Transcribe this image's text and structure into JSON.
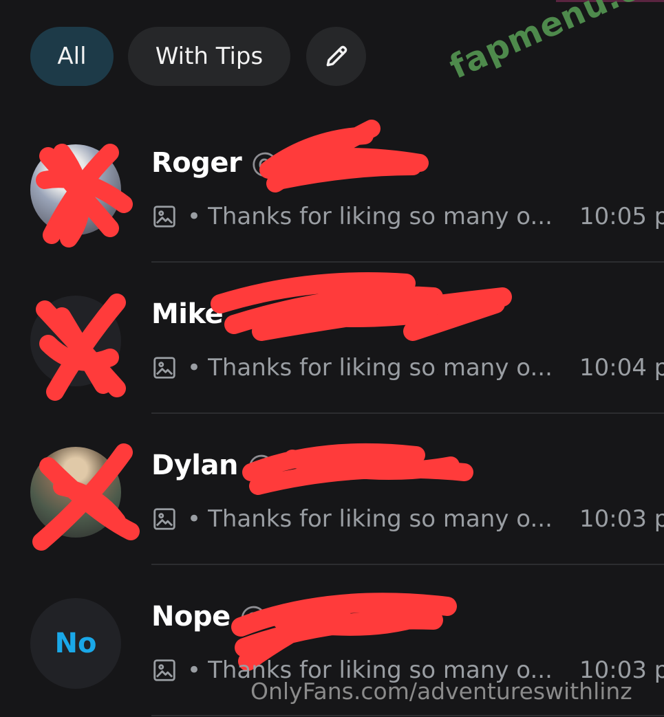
{
  "filters": {
    "all_label": "All",
    "tips_label": "With Tips",
    "edit_icon": "pencil-icon"
  },
  "conversations": [
    {
      "name": "Roger",
      "handle": "@",
      "preview_icon": "image-icon",
      "separator": "•",
      "preview": "Thanks for liking so many o...",
      "time": "10:05 p",
      "avatar": "photo"
    },
    {
      "name": "Mike",
      "handle": "",
      "preview_icon": "image-icon",
      "separator": "•",
      "preview": "Thanks for liking so many o...",
      "time": "10:04 p",
      "avatar": "photo"
    },
    {
      "name": "Dylan",
      "handle": "@",
      "preview_icon": "image-icon",
      "separator": "•",
      "preview": "Thanks for liking so many o...",
      "time": "10:03 p",
      "avatar": "photo"
    },
    {
      "name": "Nope",
      "handle": "@",
      "preview_icon": "image-icon",
      "separator": "•",
      "preview": "Thanks for liking so many o...",
      "time": "10:03 p",
      "avatar": "initials",
      "initials": "No"
    }
  ],
  "watermarks": {
    "site": "fapmenu.com",
    "source": "OnlyFans.com/adventureswithlinz"
  },
  "colors": {
    "background": "#161618",
    "chip_active": "#1d3a48",
    "chip_inactive": "#262729",
    "initials": "#1aa8e8",
    "redaction": "#ff3b3b",
    "watermark_green": "#4e8a4c"
  }
}
